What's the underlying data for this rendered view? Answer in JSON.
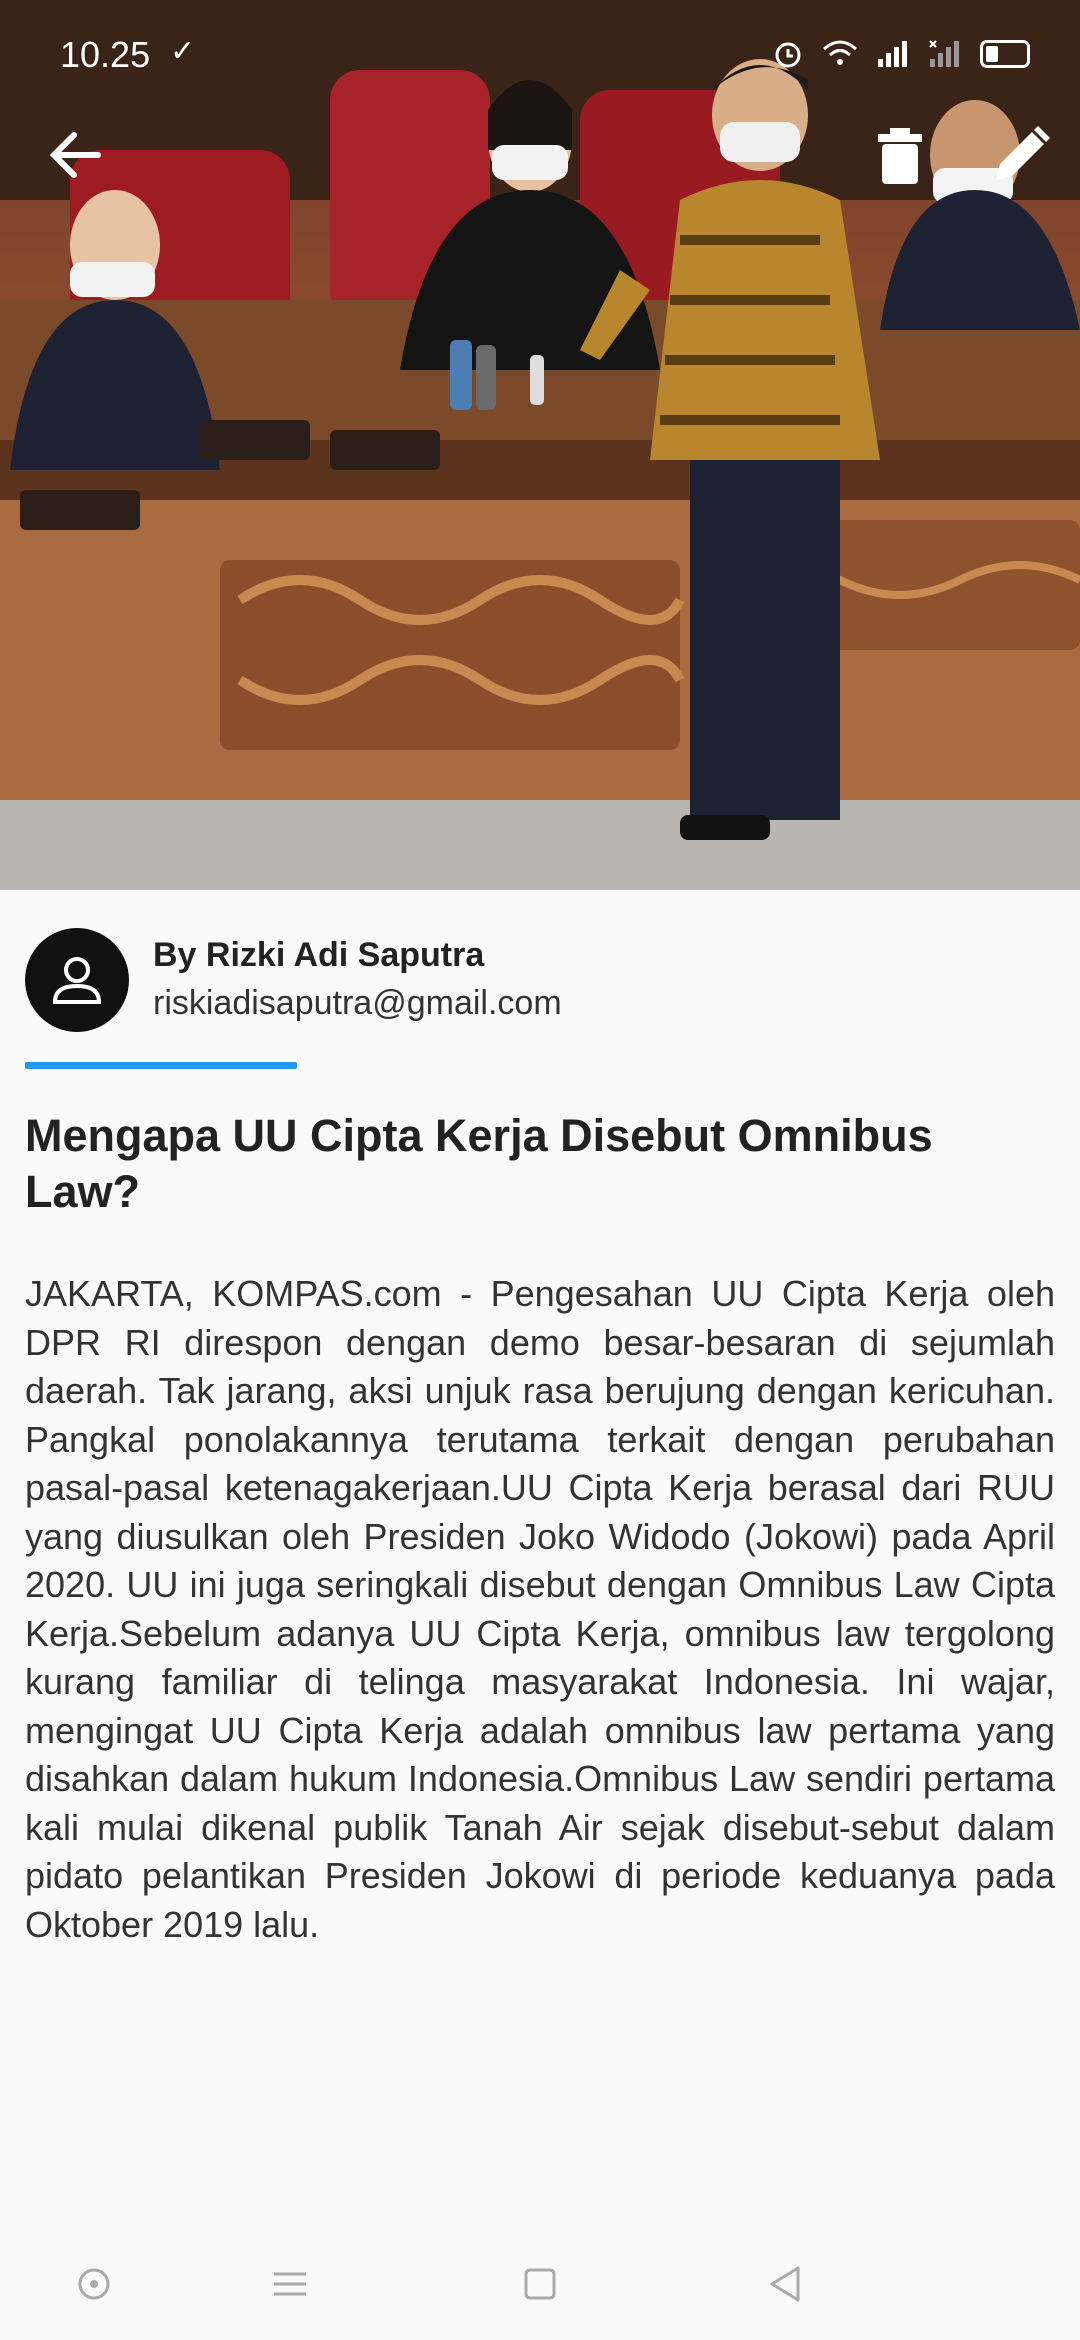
{
  "status_bar": {
    "time": "10.25",
    "check_icon": "check-icon",
    "icons": [
      "alarm-icon",
      "wifi-icon",
      "signal-icon",
      "signal-muted-icon",
      "battery-icon"
    ]
  },
  "app_bar": {
    "back_icon": "arrow-back-icon",
    "delete_icon": "trash-icon",
    "edit_icon": "pencil-icon"
  },
  "article": {
    "author_name": "By Rizki Adi Saputra",
    "author_email": "riskiadisaputra@gmail.com",
    "title": "Mengapa UU Cipta Kerja Disebut Omnibus Law?",
    "body": "JAKARTA, KOMPAS.com - Pengesahan UU Cipta Kerja oleh DPR RI direspon dengan demo besar-besaran di sejumlah daerah. Tak jarang, aksi unjuk rasa berujung dengan kericuhan. Pangkal ponolakannya terutama terkait dengan perubahan pasal-pasal ketenagakerjaan.UU Cipta Kerja berasal dari RUU yang diusulkan oleh Presiden Joko Widodo (Jokowi) pada April 2020. UU ini juga seringkali disebut dengan Omnibus Law Cipta Kerja.Sebelum adanya UU Cipta Kerja, omnibus law tergolong kurang familiar di telinga masyarakat Indonesia. Ini wajar, mengingat UU Cipta Kerja adalah omnibus law pertama yang disahkan dalam hukum Indonesia.Omnibus Law sendiri pertama kali mulai dikenal publik Tanah Air sejak disebut-sebut dalam pidato pelantikan Presiden Jokowi di periode keduanya pada Oktober 2019 lalu."
  },
  "colors": {
    "accent": "#2196f3",
    "background": "#fafafa",
    "text": "#333333"
  },
  "nav_bar": [
    "circle-icon",
    "menu-icon",
    "square-icon",
    "triangle-back-icon"
  ]
}
